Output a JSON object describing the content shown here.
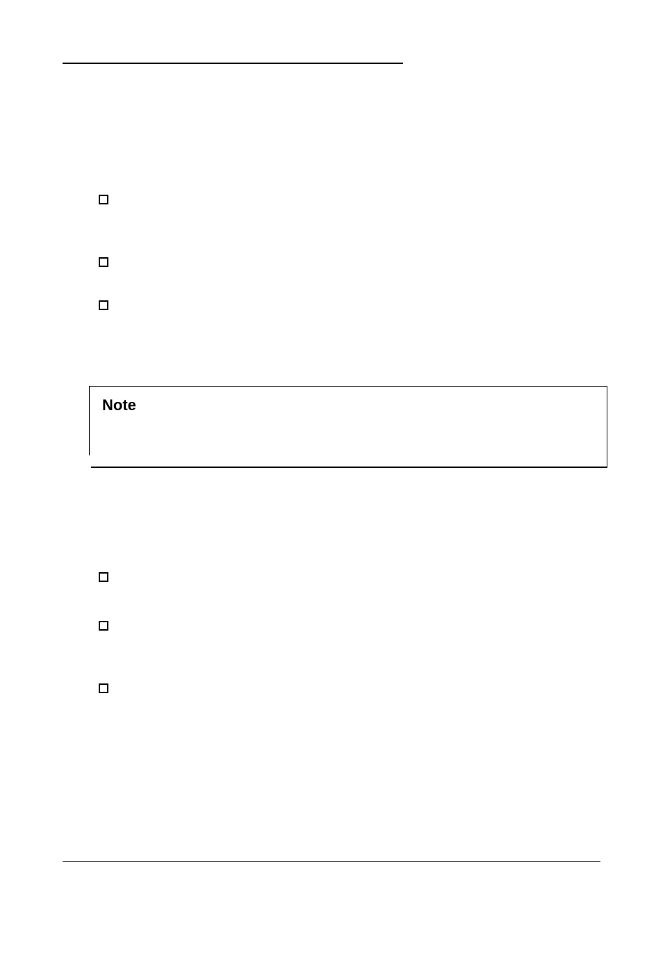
{
  "note_label": "Note",
  "bullets_top": [
    "",
    "",
    ""
  ],
  "bullets_bottom": [
    "",
    "",
    ""
  ]
}
